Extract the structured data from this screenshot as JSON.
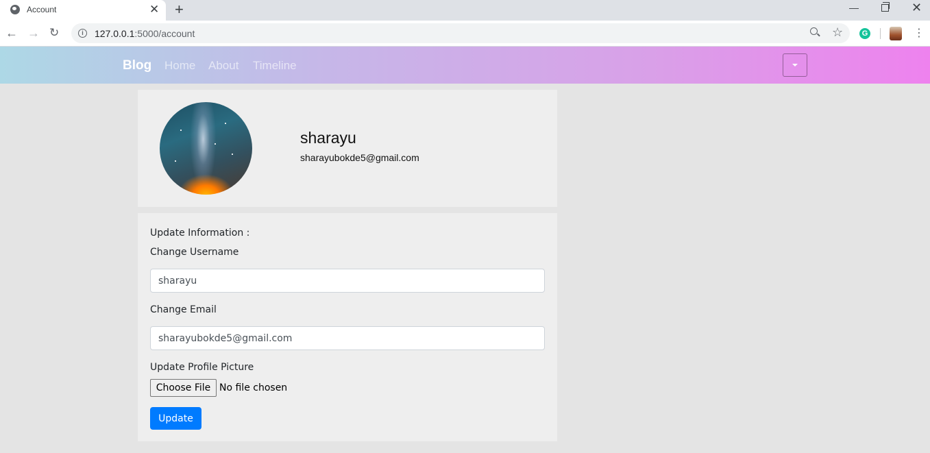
{
  "browser": {
    "tab_title": "Account",
    "url_host": "127.0.0.1",
    "url_rest": ":5000/account"
  },
  "navbar": {
    "brand": "Blog",
    "links": [
      "Home",
      "About",
      "Timeline"
    ],
    "gradient_colors": [
      "#add8e6",
      "#ee82ee"
    ]
  },
  "profile": {
    "username": "sharayu",
    "email": "sharayubokde5@gmail.com"
  },
  "form": {
    "legend": "Update Information :",
    "username_label": "Change Username",
    "username_value": "sharayu",
    "email_label": "Change Email",
    "email_value": "sharayubokde5@gmail.com",
    "picture_label": "Update Profile Picture",
    "file_button": "Choose File",
    "file_status": "No file chosen",
    "submit_label": "Update",
    "submit_color": "#007bff"
  }
}
